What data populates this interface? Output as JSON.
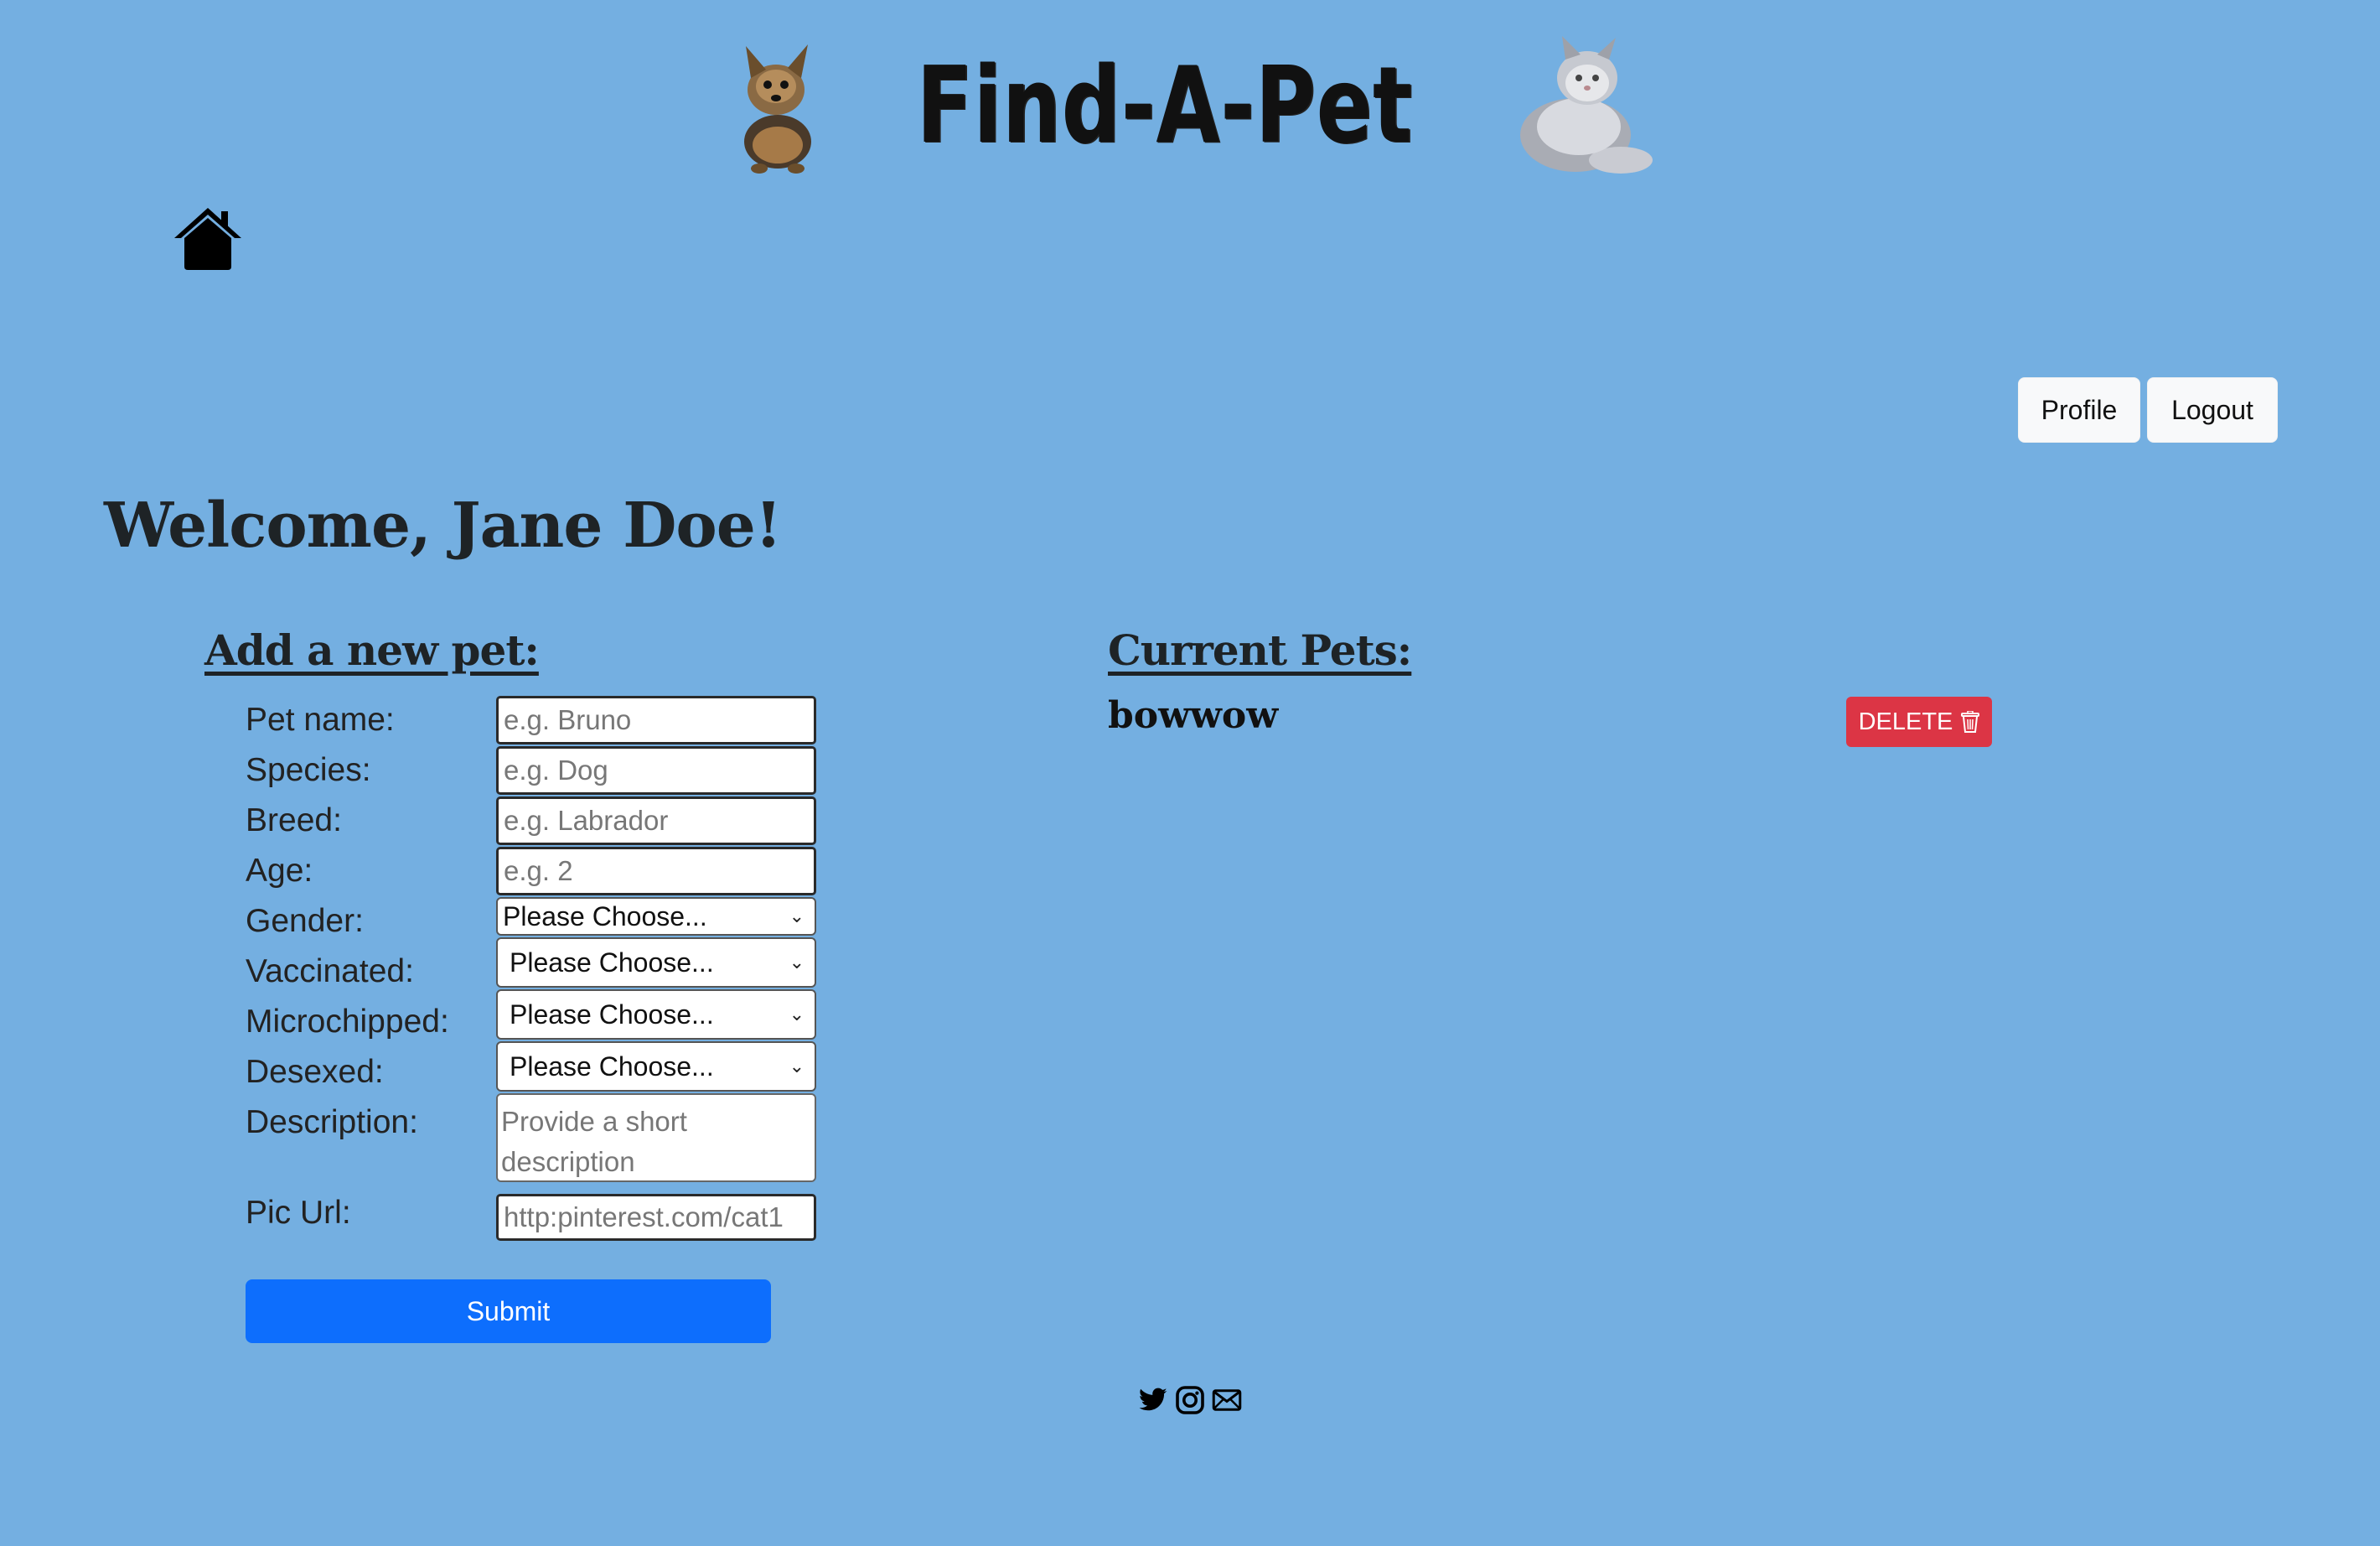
{
  "header": {
    "title": "Find-A-Pet",
    "home_icon": "home-icon",
    "profile_label": "Profile",
    "logout_label": "Logout"
  },
  "welcome": "Welcome, Jane Doe!",
  "add_pet": {
    "title": "Add a new pet:",
    "fields": {
      "pet_name": {
        "label": "Pet name:",
        "placeholder": "e.g. Bruno",
        "value": ""
      },
      "species": {
        "label": "Species:",
        "placeholder": "e.g. Dog",
        "value": ""
      },
      "breed": {
        "label": "Breed:",
        "placeholder": "e.g. Labrador",
        "value": ""
      },
      "age": {
        "label": "Age:",
        "placeholder": "e.g. 2",
        "value": ""
      },
      "gender": {
        "label": "Gender:",
        "selected": "Please Choose..."
      },
      "vaccinated": {
        "label": "Vaccinated:",
        "selected": "Please Choose..."
      },
      "microchipped": {
        "label": "Microchipped:",
        "selected": "Please Choose..."
      },
      "desexed": {
        "label": "Desexed:",
        "selected": "Please Choose..."
      },
      "description": {
        "label": "Description:",
        "placeholder": "Provide a short description",
        "value": ""
      },
      "pic_url": {
        "label": "Pic Url:",
        "placeholder": "http:pinterest.com/cat1",
        "value": ""
      }
    },
    "submit_label": "Submit"
  },
  "current_pets": {
    "title": "Current Pets:",
    "pets": [
      {
        "name": "bowwow",
        "delete_label": "DELETE",
        "delete_icon": "trash-icon"
      }
    ]
  },
  "footer": {
    "icons": [
      "twitter-icon",
      "instagram-icon",
      "mail-icon"
    ]
  },
  "colors": {
    "background": "#74afe1",
    "primary": "#0d6efd",
    "danger": "#dc3545",
    "light_button": "#f8f9fa"
  }
}
